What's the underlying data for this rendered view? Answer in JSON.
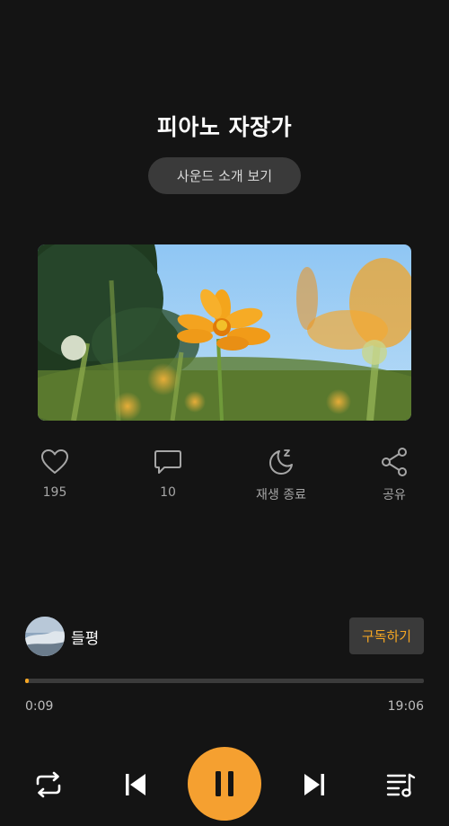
{
  "track": {
    "title": "피아노 자장가",
    "intro_button": "사운드 소개 보기"
  },
  "actions": {
    "like": {
      "icon": "heart-icon",
      "label": "195"
    },
    "comment": {
      "icon": "comment-icon",
      "label": "10"
    },
    "sleep_timer": {
      "icon": "moon-timer-icon",
      "label": "재생 종료"
    },
    "share": {
      "icon": "share-icon",
      "label": "공유"
    }
  },
  "channel": {
    "name": "들평",
    "subscribe_label": "구독하기"
  },
  "player": {
    "current_time": "0:09",
    "total_time": "19:06",
    "progress_fraction": 0.008,
    "state": "playing"
  },
  "controls": {
    "repeat": "repeat-icon",
    "previous": "skip-previous-icon",
    "pause": "pause-icon",
    "next": "skip-next-icon",
    "playlist": "playlist-icon"
  },
  "colors": {
    "background": "#141414",
    "accent": "#f5a623",
    "muted_text": "#a6a6a6",
    "chip_bg": "#3a3a3a"
  }
}
